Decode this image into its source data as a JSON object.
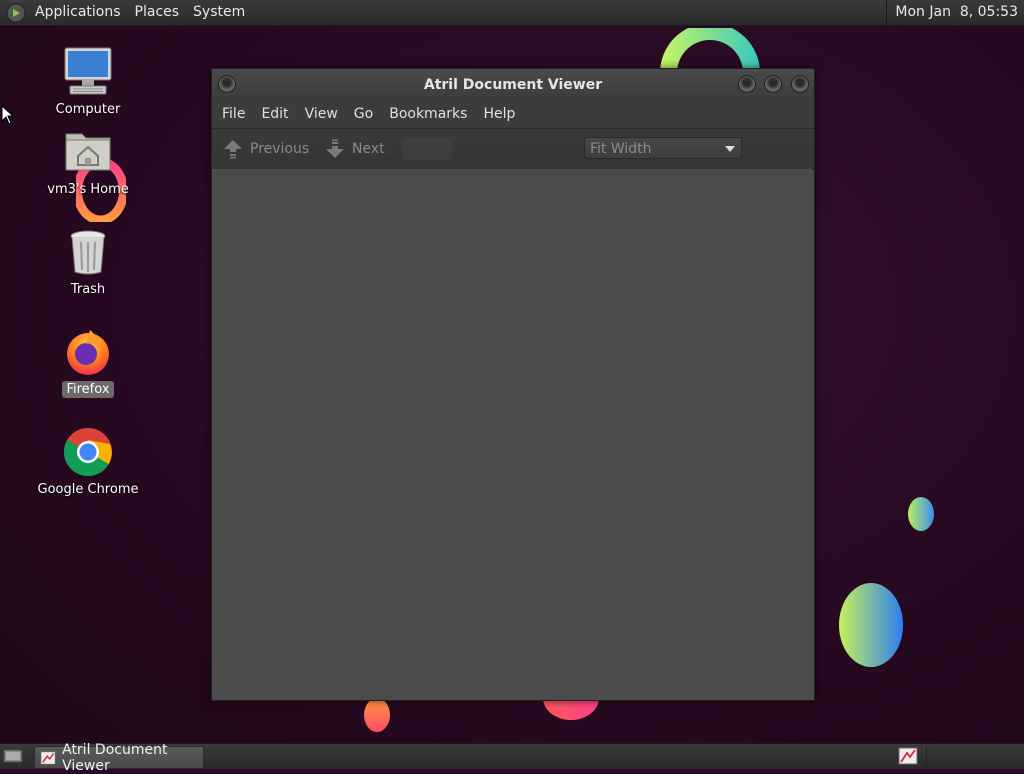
{
  "top_panel": {
    "menus": [
      "Applications",
      "Places",
      "System"
    ],
    "clock": "Mon Jan  8, 05:53"
  },
  "desktop_icons": [
    {
      "label": "Computer",
      "icon": "computer-icon"
    },
    {
      "label": "vm3's Home",
      "icon": "home-folder-icon"
    },
    {
      "label": "Trash",
      "icon": "trash-icon"
    },
    {
      "label": "Firefox",
      "icon": "firefox-icon",
      "selected": true
    },
    {
      "label": "Google Chrome",
      "icon": "chrome-icon"
    }
  ],
  "window": {
    "title": "Atril Document Viewer",
    "menus": [
      "File",
      "Edit",
      "View",
      "Go",
      "Bookmarks",
      "Help"
    ],
    "toolbar": {
      "previous_label": "Previous",
      "next_label": "Next",
      "page_value": "",
      "zoom_value": "Fit Width"
    }
  },
  "taskbar": {
    "tasks": [
      {
        "label": "Atril Document Viewer",
        "icon": "atril-icon"
      }
    ]
  },
  "colors": {
    "desktop_bg": "#260920",
    "panel_bg": "#2b2b2b",
    "window_bg": "#4b4b4b"
  }
}
